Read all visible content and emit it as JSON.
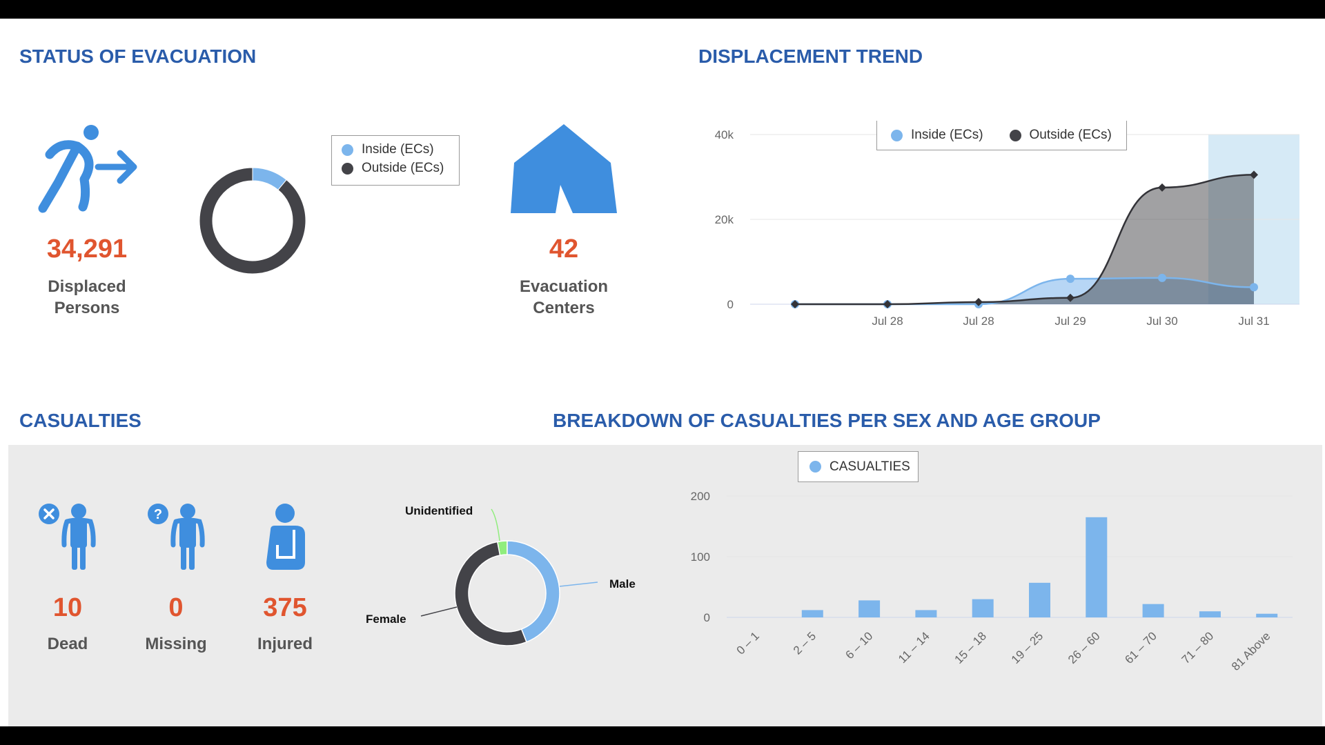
{
  "colors": {
    "title": "#2a5caa",
    "number": "#e0552f",
    "icon": "#3f8ede",
    "inside": "#7cb5ec",
    "outside": "#434348",
    "unidentified": "#90ed7d"
  },
  "evacuation": {
    "title": "STATUS OF EVACUATION",
    "displaced": {
      "value": "34,291",
      "label_line1": "Displaced",
      "label_line2": "Persons",
      "icon": "running-person-exit-icon"
    },
    "centers": {
      "value": "42",
      "label_line1": "Evacuation",
      "label_line2": "Centers",
      "icon": "tent-icon"
    },
    "legend": [
      "Inside (ECs)",
      "Outside (ECs)"
    ]
  },
  "trend": {
    "title": "DISPLACEMENT TREND",
    "legend": [
      "Inside (ECs)",
      "Outside (ECs)"
    ]
  },
  "casualties": {
    "title": "CASUALTIES",
    "items": [
      {
        "value": "10",
        "label": "Dead",
        "icon": "person-x-icon"
      },
      {
        "value": "0",
        "label": "Missing",
        "icon": "person-question-icon"
      },
      {
        "value": "375",
        "label": "Injured",
        "icon": "person-arm-sling-icon"
      }
    ]
  },
  "breakdown": {
    "title": "BREAKDOWN OF CASUALTIES PER SEX AND AGE GROUP",
    "legend": "CASUALTIES"
  },
  "chart_data": [
    {
      "type": "pie",
      "variant": "donut",
      "series": [
        {
          "name": "Inside (ECs)",
          "value": 0.11
        },
        {
          "name": "Outside (ECs)",
          "value": 0.89
        }
      ],
      "legend_placement": "right"
    },
    {
      "type": "area",
      "x": [
        "",
        "Jul 28",
        "Jul 28",
        "Jul 29",
        "Jul 30",
        "Jul 31"
      ],
      "series": [
        {
          "name": "Inside (ECs)",
          "values": [
            0,
            0,
            0,
            6000,
            6200,
            4000
          ]
        },
        {
          "name": "Outside (ECs)",
          "values": [
            0,
            0,
            500,
            1500,
            27500,
            30500
          ]
        }
      ],
      "yticks": [
        "0",
        "20k",
        "40k"
      ],
      "ylim": [
        0,
        40000
      ],
      "grid": true,
      "legend_placement": "top",
      "highlighted_category": "Jul 31"
    },
    {
      "type": "pie",
      "variant": "donut",
      "series": [
        {
          "name": "Unidentified",
          "value": 3
        },
        {
          "name": "Male",
          "value": 44
        },
        {
          "name": "Female",
          "value": 53
        }
      ]
    },
    {
      "type": "bar",
      "categories": [
        "0 – 1",
        "2 – 5",
        "6 – 10",
        "11 – 14",
        "15 – 18",
        "19 – 25",
        "26 – 60",
        "61 – 70",
        "71 – 80",
        "81 Above"
      ],
      "series": [
        {
          "name": "CASUALTIES",
          "values": [
            0,
            12,
            28,
            12,
            30,
            57,
            165,
            22,
            10,
            6
          ]
        }
      ],
      "yticks": [
        "0",
        "100",
        "200"
      ],
      "ylim": [
        0,
        200
      ],
      "grid": true,
      "legend_placement": "top"
    }
  ]
}
